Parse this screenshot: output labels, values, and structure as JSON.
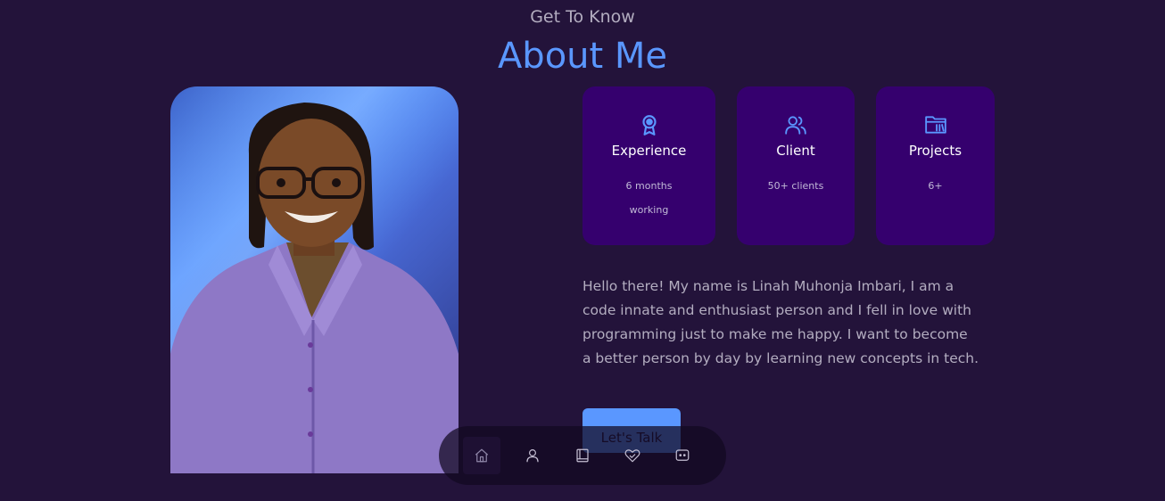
{
  "header": {
    "subtitle": "Get To Know",
    "title": "About Me"
  },
  "profile_image": {
    "alt": "Linah Muhonja Imbari portrait"
  },
  "cards": [
    {
      "icon": "award-icon",
      "title": "Experience",
      "sub_line1": "6 months",
      "sub_line2": "working"
    },
    {
      "icon": "users-icon",
      "title": "Client",
      "sub_line1": "50+ clients",
      "sub_line2": ""
    },
    {
      "icon": "folder-icon",
      "title": "Projects",
      "sub_line1": "6+",
      "sub_line2": ""
    }
  ],
  "bio": {
    "lines": [
      "Hello there! My name is Linah Muhonja Imbari, I am a",
      "code innate and enthusiast person and I fell in love with",
      "programming just to make me happy. I want to become",
      "a better person by day by learning new concepts in tech."
    ]
  },
  "cta": {
    "label": "Let's Talk"
  },
  "nav": {
    "items": [
      {
        "icon": "home-icon",
        "active": true
      },
      {
        "icon": "user-icon",
        "active": false
      },
      {
        "icon": "book-icon",
        "active": false
      },
      {
        "icon": "heart-hand-icon",
        "active": false
      },
      {
        "icon": "chat-icon",
        "active": false
      }
    ]
  },
  "colors": {
    "background": "#23133a",
    "accent": "#5a97ff",
    "card": "#35006e",
    "muted_text": "#b3adc0"
  }
}
